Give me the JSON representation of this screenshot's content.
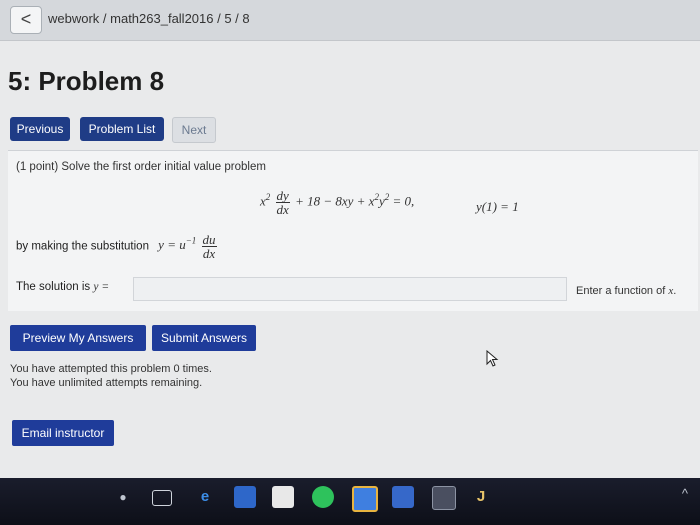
{
  "browser": {
    "back_label": "<",
    "breadcrumb": "webwork / math263_fall2016 / 5 / 8"
  },
  "page": {
    "title": "5: Problem 8"
  },
  "nav": {
    "previous": "Previous",
    "problem_list": "Problem List",
    "next": "Next"
  },
  "problem": {
    "intro": "(1 point) Solve the first order initial value problem",
    "equation": {
      "x_sq": "x",
      "sq": "2",
      "dy": "dy",
      "dx": "dx",
      "rest_a": "+ 18 − 8xy + x",
      "sq2": "2",
      "rest_b": "y",
      "sq3": "2",
      "rest_c": " = 0,"
    },
    "initial_condition": "y(1) = 1",
    "substitution_text": "by making the substitution",
    "substitution": {
      "lhs": "y = u",
      "exp": "−1",
      "du": "du",
      "dx": "dx"
    },
    "solution_label": "The solution is",
    "solution_var": "y =",
    "answer_value": "",
    "answer_hint_prefix": "Enter a function of",
    "answer_hint_var": "x",
    "answer_hint_suffix": "."
  },
  "actions": {
    "preview": "Preview My Answers",
    "submit": "Submit Answers"
  },
  "status": {
    "attempts_line": "You have attempted this problem 0 times.",
    "remaining_line": "You have unlimited attempts remaining."
  },
  "footer": {
    "email": "Email instructor"
  },
  "taskbar": {
    "icons": [
      "task-view-icon",
      "edge-icon",
      "store-icon",
      "windows-store-icon",
      "spotify-icon",
      "chrome-icon",
      "mail-icon",
      "calculator-icon",
      "app-j-icon"
    ],
    "j_label": "J",
    "overflow": "^"
  },
  "colors": {
    "primary_button": "#1f3c86",
    "action_button": "#1f3c9a",
    "taskbar": "#12141f"
  }
}
